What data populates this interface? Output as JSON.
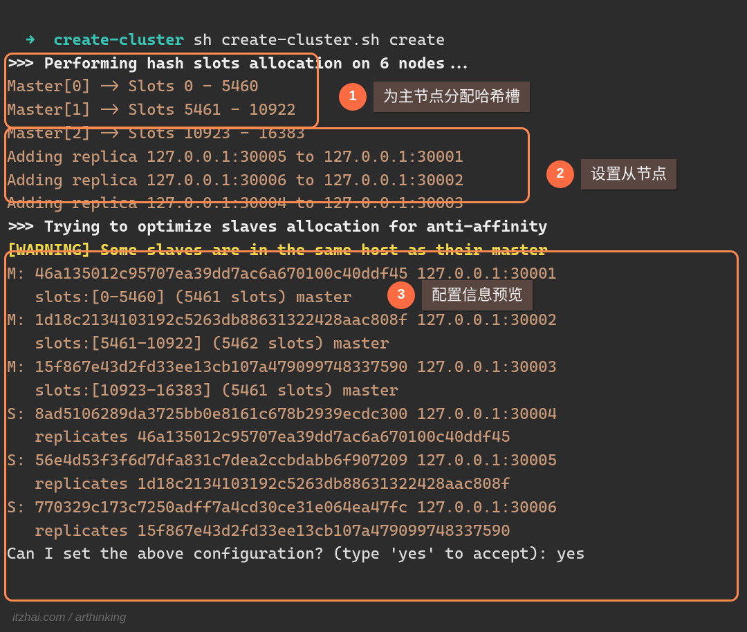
{
  "prompt": {
    "arrow": "→",
    "dir": "create-cluster",
    "cmd": "sh create-cluster.sh create"
  },
  "perform": ">>> Performing hash slots allocation on 6 nodes...",
  "masters": [
    "Master[0] -> Slots 0 - 5460",
    "Master[1] -> Slots 5461 - 10922",
    "Master[2] -> Slots 10923 - 16383"
  ],
  "replicas": [
    "Adding replica 127.0.0.1:30005 to 127.0.0.1:30001",
    "Adding replica 127.0.0.1:30006 to 127.0.0.1:30002",
    "Adding replica 127.0.0.1:30004 to 127.0.0.1:30003"
  ],
  "optimize": ">>> Trying to optimize slaves allocation for anti-affinity",
  "warning": {
    "bracket": "[WARNING]",
    "text": " Some slaves are in the same host as their master"
  },
  "nodes": [
    "M: 46a135012c95707ea39dd7ac6a670100c40ddf45 127.0.0.1:30001",
    "   slots:[0-5460] (5461 slots) master",
    "M: 1d18c2134103192c5263db88631322428aac808f 127.0.0.1:30002",
    "   slots:[5461-10922] (5462 slots) master",
    "M: 15f867e43d2fd33ee13cb107a479099748337590 127.0.0.1:30003",
    "   slots:[10923-16383] (5461 slots) master",
    "S: 8ad5106289da3725bb0e8161c678b2939ecdc300 127.0.0.1:30004",
    "   replicates 46a135012c95707ea39dd7ac6a670100c40ddf45",
    "S: 56e4d53f3f6d7dfa831c7dea2ccbdabb6f907209 127.0.0.1:30005",
    "   replicates 1d18c2134103192c5263db88631322428aac808f",
    "S: 770329c173c7250adff7a4cd30ce31e064ea47fc 127.0.0.1:30006",
    "   replicates 15f867e43d2fd33ee13cb107a479099748337590"
  ],
  "confirm": {
    "q": "Can I set the above configuration? (type 'yes' to accept): ",
    "a": "yes"
  },
  "callouts": {
    "c1": {
      "num": "1",
      "label": "为主节点分配哈希槽"
    },
    "c2": {
      "num": "2",
      "label": "设置从节点"
    },
    "c3": {
      "num": "3",
      "label": "配置信息预览"
    }
  },
  "watermark": "itzhai.com / arthinking"
}
